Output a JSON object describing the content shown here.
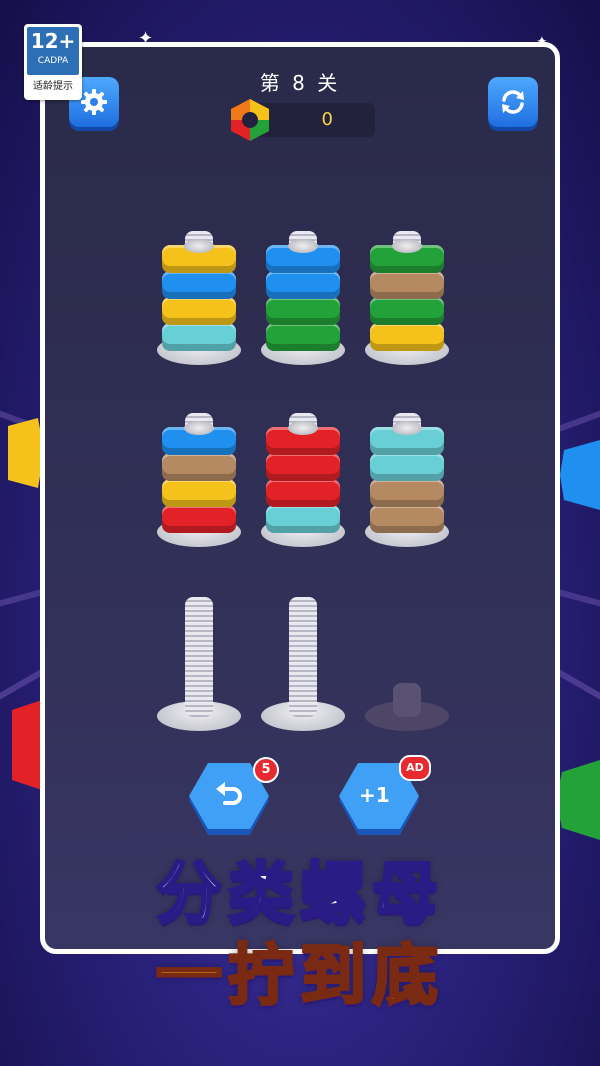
{
  "age_rating": {
    "number": "12+",
    "org": "CADPA",
    "tip": "适龄提示"
  },
  "level_title": "第 8 关",
  "score": "0",
  "buttons": {
    "settings": "settings",
    "restart": "restart"
  },
  "undo": {
    "count": "5"
  },
  "add_peg": {
    "label": "+1",
    "badge": "AD"
  },
  "title": {
    "line1": "分类螺母",
    "line2": "一拧到底"
  },
  "colors": {
    "yellow": "#f4c21b",
    "blue": "#1f8ff0",
    "green": "#24a23a",
    "tan": "#b58a63",
    "cyan": "#68cfd6",
    "red": "#e32228"
  },
  "pegs": [
    {
      "nuts": [
        "yellow",
        "blue",
        "yellow",
        "cyan"
      ]
    },
    {
      "nuts": [
        "blue",
        "blue",
        "green",
        "green"
      ]
    },
    {
      "nuts": [
        "green",
        "tan",
        "green",
        "yellow"
      ]
    },
    {
      "nuts": [
        "blue",
        "tan",
        "yellow",
        "red"
      ]
    },
    {
      "nuts": [
        "red",
        "red",
        "red",
        "cyan"
      ]
    },
    {
      "nuts": [
        "cyan",
        "cyan",
        "tan",
        "tan"
      ]
    },
    {
      "nuts": []
    },
    {
      "nuts": []
    },
    {
      "nuts": [],
      "locked": true
    }
  ]
}
